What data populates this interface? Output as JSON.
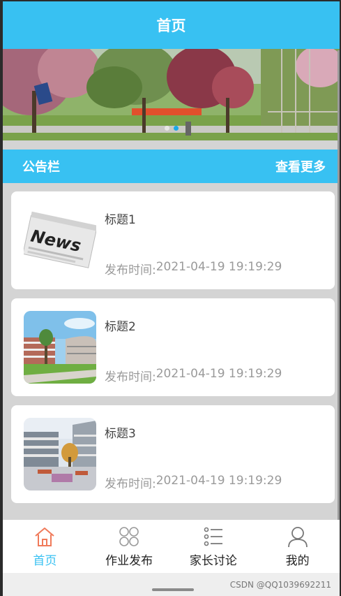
{
  "header": {
    "title": "首页"
  },
  "banner": {
    "slide_count": 2,
    "active_slide": 1
  },
  "notice": {
    "title": "公告栏",
    "more_label": "查看更多"
  },
  "items": [
    {
      "title": "标题1",
      "time_label": "发布时间:",
      "time": "2021-04-19 19:19:29",
      "thumb": "news-newspaper-image"
    },
    {
      "title": "标题2",
      "time_label": "发布时间:",
      "time": "2021-04-19 19:19:29",
      "thumb": "school-building-image"
    },
    {
      "title": "标题3",
      "time_label": "发布时间:",
      "time": "2021-04-19 19:19:29",
      "thumb": "school-courtyard-image"
    }
  ],
  "tabs": [
    {
      "label": "首页",
      "icon": "home-icon",
      "active": true
    },
    {
      "label": "作业发布",
      "icon": "grid-icon",
      "active": false
    },
    {
      "label": "家长讨论",
      "icon": "list-icon",
      "active": false
    },
    {
      "label": "我的",
      "icon": "user-icon",
      "active": false
    }
  ],
  "watermark": "CSDN @QQ1039692211",
  "colors": {
    "primary": "#38c1f2",
    "background": "#d4d4d4",
    "accent_home": "#f07a5a"
  }
}
